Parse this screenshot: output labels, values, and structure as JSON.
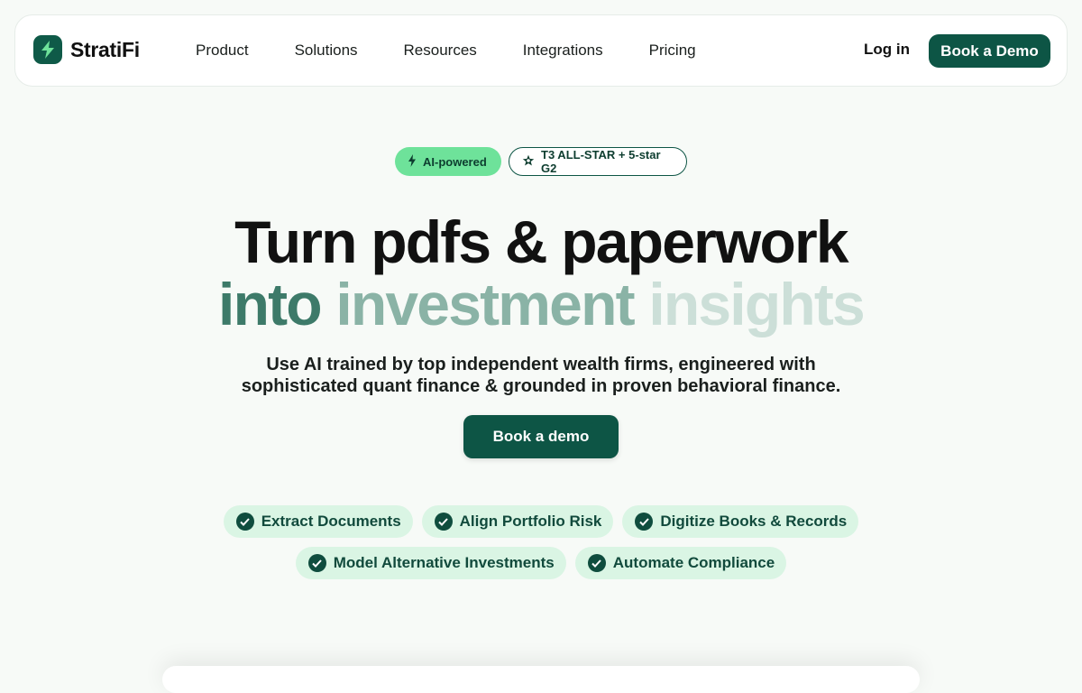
{
  "brand": {
    "name": "StratiFi",
    "logo_icon": "lightning-icon",
    "color": "#0d5545"
  },
  "nav": {
    "links": [
      "Product",
      "Solutions",
      "Resources",
      "Integrations",
      "Pricing"
    ],
    "login_label": "Log in",
    "cta_label": "Book a Demo"
  },
  "badges": {
    "ai": {
      "label": "AI-powered",
      "icon": "lightning-icon",
      "color": "#6ee29a"
    },
    "award": {
      "label": "T3 ALL-STAR + 5-star G2",
      "icon": "star-badge-icon"
    }
  },
  "hero": {
    "line1": "Turn pdfs & paperwork",
    "line2_word1": "into",
    "line2_word2": "investment",
    "line2_word3": "insights",
    "subtitle_line1": "Use AI trained by top independent wealth firms, engineered with",
    "subtitle_line2": "sophisticated quant finance & grounded in proven behavioral finance.",
    "cta_label": "Book a demo"
  },
  "features": {
    "row1": [
      "Extract Documents",
      "Align Portfolio Risk",
      "Digitize Books & Records"
    ],
    "row2": [
      "Model Alternative Investments",
      "Automate Compliance"
    ]
  },
  "colors": {
    "accent": "#0d5545",
    "chip_bg": "#daf5e4",
    "heading_mid": "#3d7a69",
    "heading_light": "#8ab3a6",
    "heading_faint": "#ccdfd8"
  }
}
